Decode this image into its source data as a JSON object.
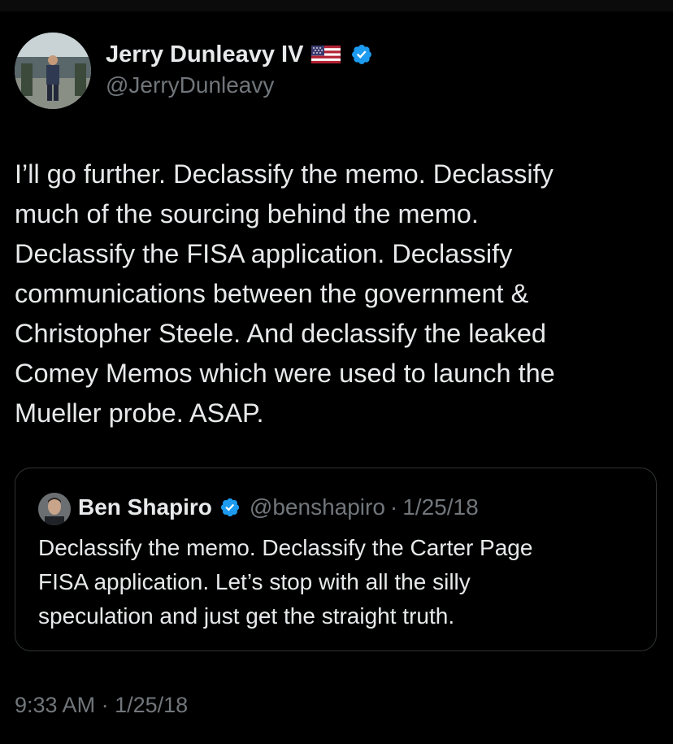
{
  "colors": {
    "background": "#000000",
    "text_primary": "#e7e9ea",
    "text_secondary": "#71767b",
    "verified_badge": "#1d9bf0",
    "card_border": "#2f3336"
  },
  "author": {
    "display_name": "Jerry Dunleavy IV",
    "flag_icon": "us-flag-icon",
    "verified_icon": "verified-badge-icon",
    "handle": "@JerryDunleavy"
  },
  "tweet": {
    "text": "I’ll go further. Declassify the memo. Declassify\nmuch of the sourcing behind the memo.\nDeclassify the FISA application. Declassify\ncommunications between the government &\nChristopher Steele. And declassify the leaked\nComey Memos which were used to launch the\nMueller probe. ASAP."
  },
  "quoted_tweet": {
    "display_name": "Ben Shapiro",
    "verified_icon": "verified-badge-icon",
    "handle": "@benshapiro",
    "separator": "·",
    "date": "1/25/18",
    "text": "Declassify the memo. Declassify the Carter Page\nFISA application. Let’s stop with all the silly\nspeculation and just get the straight truth."
  },
  "meta": {
    "time": "9:33 AM",
    "separator": "·",
    "date": "1/25/18"
  }
}
